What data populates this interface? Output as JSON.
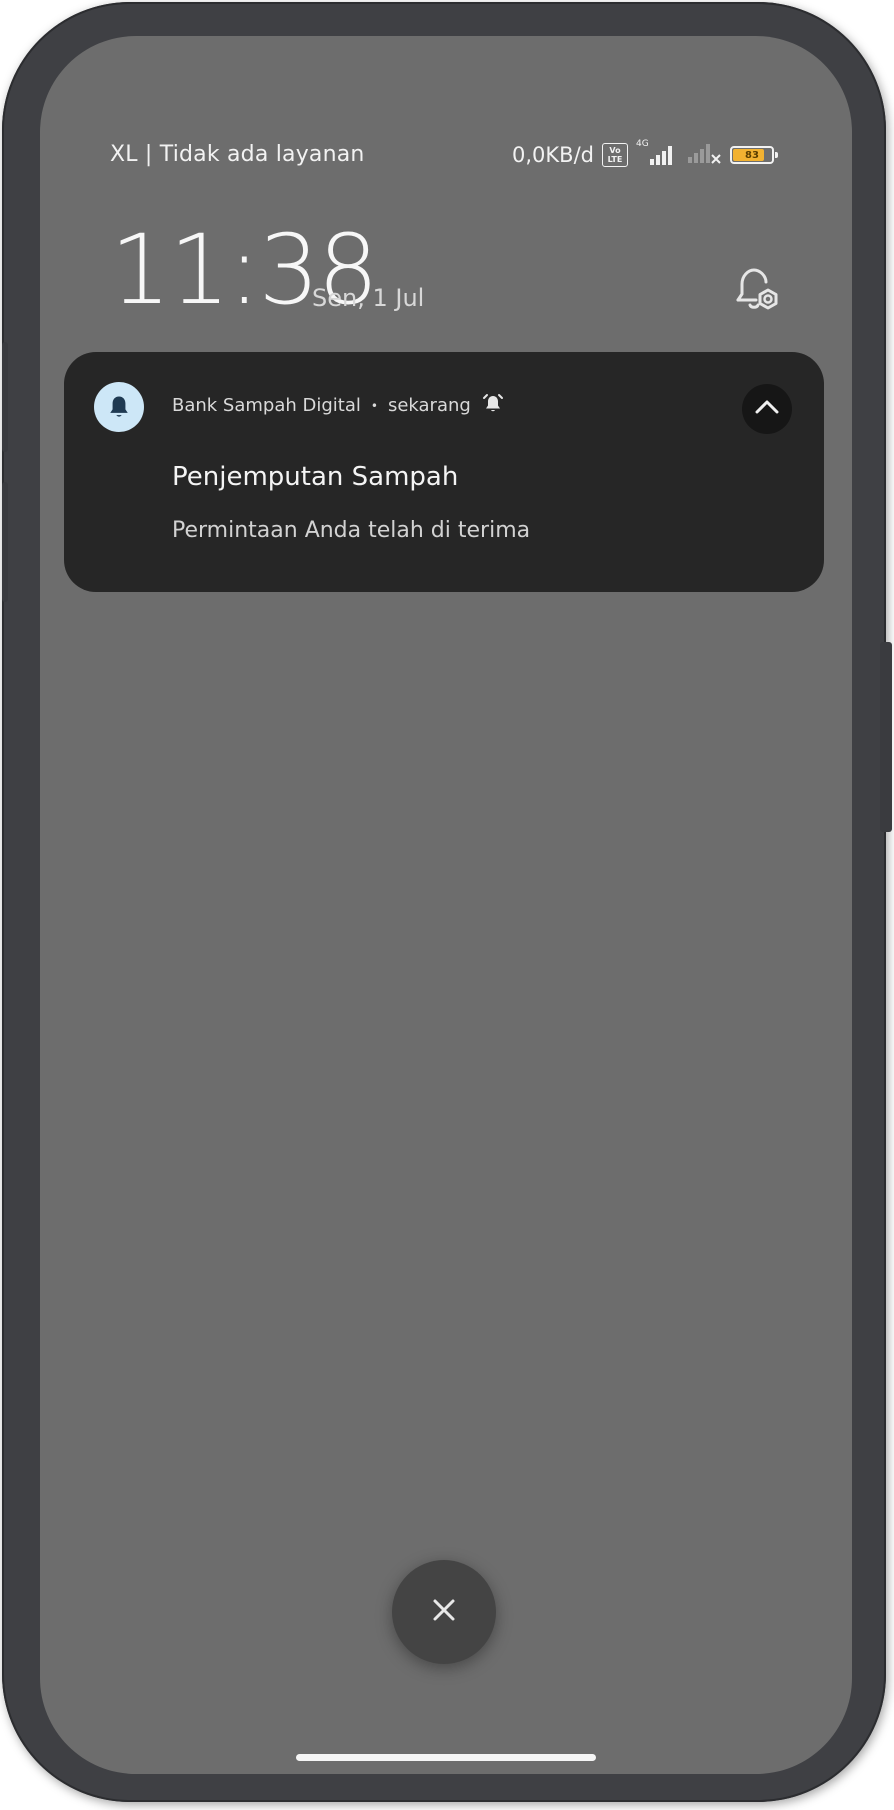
{
  "status_bar": {
    "carrier": "XL | Tidak ada layanan",
    "network_speed": "0,0KB/d",
    "volte_top": "Vo",
    "volte_bottom": "LTE",
    "network_type": "4G",
    "battery_level": "83",
    "battery_fraction": 0.83,
    "battery_color": "#f2b231"
  },
  "lockscreen": {
    "time": "11:38",
    "date": "Sen, 1 Jul",
    "settings_icon": "notification-settings-icon"
  },
  "notification": {
    "app_name": "Bank Sampah Digital",
    "separator": "•",
    "timestamp": "sekarang",
    "title": "Penjemputan Sampah",
    "body": "Permintaan Anda telah di terima",
    "app_icon": "bell-icon",
    "app_icon_bg": "#cde7f7",
    "alert_icon": "alarm-bell-icon",
    "collapse_icon": "chevron-up-icon"
  },
  "controls": {
    "dismiss_icon": "close-icon"
  }
}
